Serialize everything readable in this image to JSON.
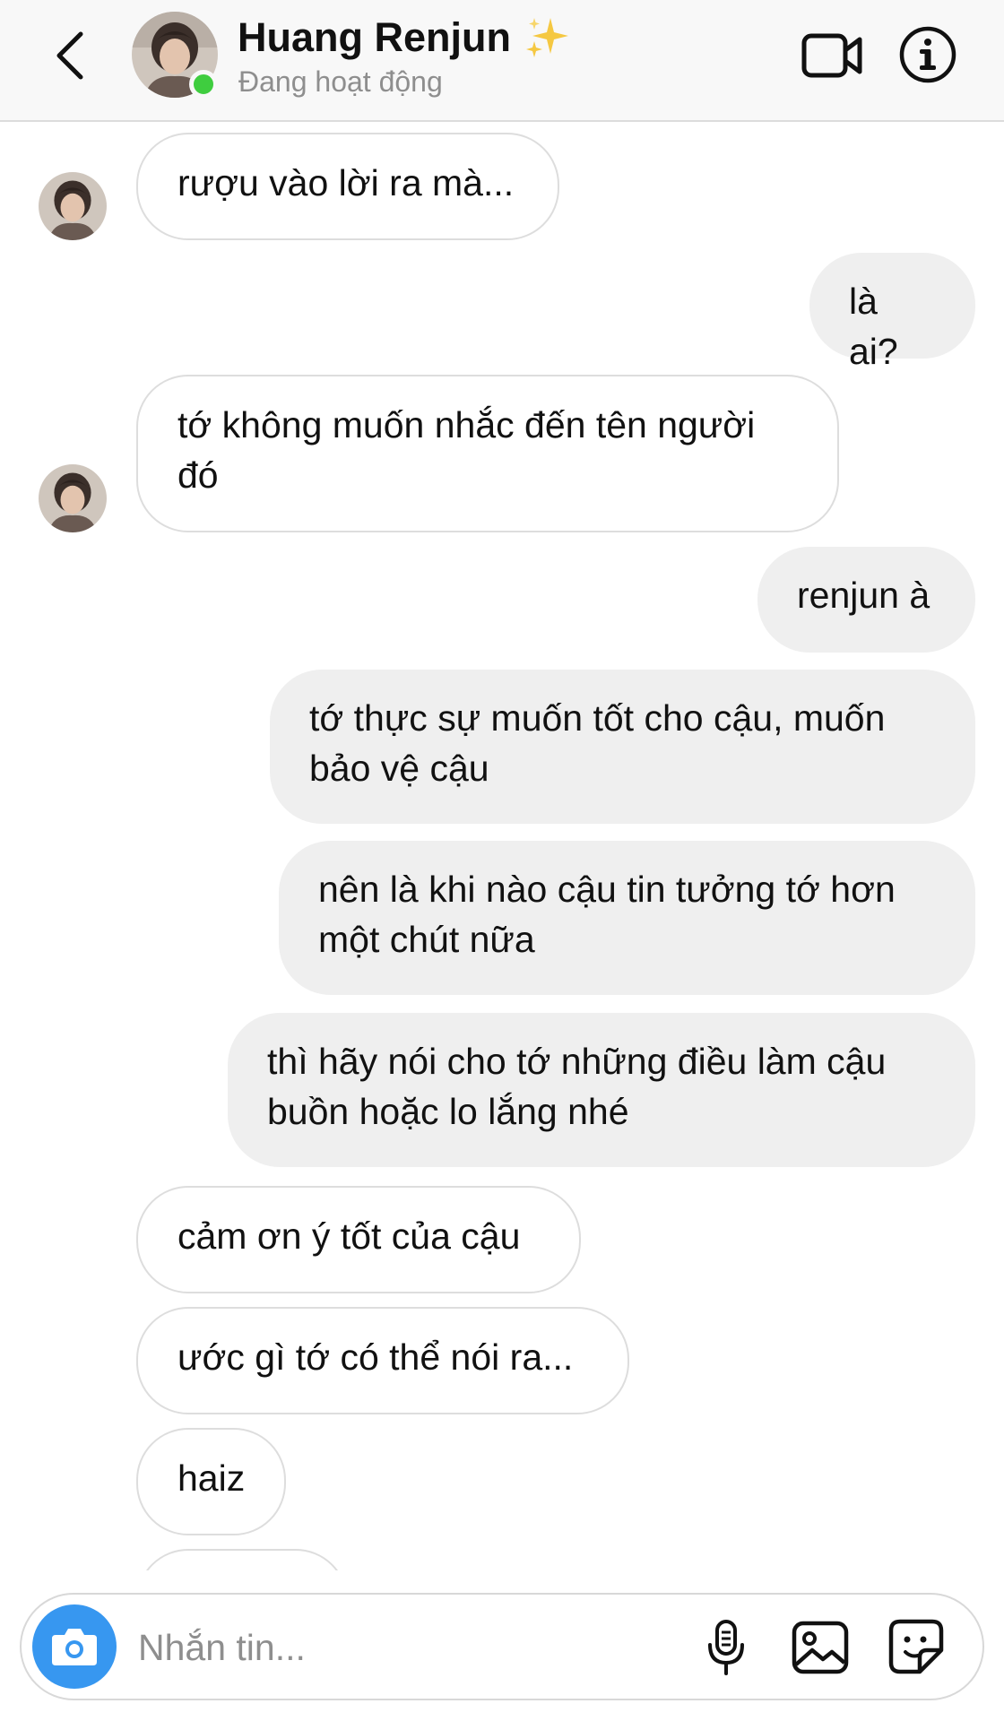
{
  "header": {
    "name": "Huang Renjun",
    "status": "Đang hoạt động",
    "icons": {
      "back": "chevron-left-icon",
      "name_decoration": "sparkles-icon",
      "video_call": "video-camera-icon",
      "info": "info-icon"
    },
    "online_color": "#3fcd3f"
  },
  "messages": [
    {
      "from": "them",
      "text": "rượu vào lời ra mà...",
      "show_avatar": true
    },
    {
      "from": "me",
      "text": "là ai?"
    },
    {
      "from": "them",
      "text": "tớ không muốn nhắc đến tên người\nđó",
      "show_avatar": true
    },
    {
      "from": "me",
      "text": "renjun à"
    },
    {
      "from": "me",
      "text": "tớ thực sự muốn tốt cho cậu, muốn\nbảo vệ cậu"
    },
    {
      "from": "me",
      "text": "nên là khi nào cậu tin tưởng tớ hơn\nmột chút nữa"
    },
    {
      "from": "me",
      "text": "thì hãy nói cho tớ những điều làm cậu\nbuồn hoặc lo lắng nhé"
    },
    {
      "from": "them",
      "text": "cảm ơn ý tốt của cậu"
    },
    {
      "from": "them",
      "text": "ước gì tớ có thể nói ra..."
    },
    {
      "from": "them",
      "text": "haiz"
    },
    {
      "from": "them",
      "text": ""
    }
  ],
  "composer": {
    "placeholder": "Nhắn tin...",
    "icons": {
      "camera": "camera-icon",
      "microphone": "microphone-icon",
      "gallery": "image-gallery-icon",
      "sticker": "sticker-icon"
    },
    "camera_color": "#3797f0"
  },
  "colors": {
    "incoming_bubble": "#ffffff",
    "outgoing_bubble": "#efefef",
    "muted_text": "#8e8e8e"
  }
}
